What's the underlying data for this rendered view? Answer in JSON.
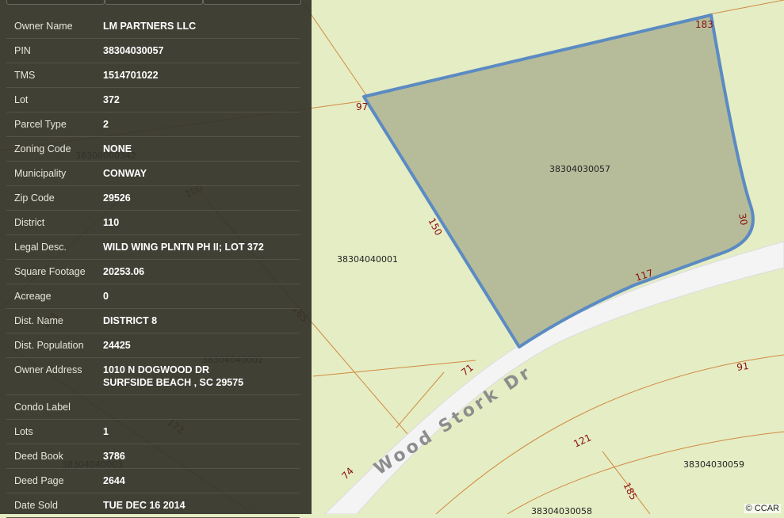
{
  "parcel_panel": {
    "rows": [
      {
        "label": "Owner Name",
        "value": "LM PARTNERS LLC"
      },
      {
        "label": "PIN",
        "value": "38304030057"
      },
      {
        "label": "TMS",
        "value": "1514701022"
      },
      {
        "label": "Lot",
        "value": "372"
      },
      {
        "label": "Parcel Type",
        "value": "2"
      },
      {
        "label": "Zoning Code",
        "value": "NONE"
      },
      {
        "label": "Municipality",
        "value": "CONWAY"
      },
      {
        "label": "Zip Code",
        "value": "29526"
      },
      {
        "label": "District",
        "value": "110"
      },
      {
        "label": "Legal Desc.",
        "value": "WILD WING PLNTN PH II; LOT 372"
      },
      {
        "label": "Square Footage",
        "value": "20253.06"
      },
      {
        "label": "Acreage",
        "value": "0"
      },
      {
        "label": "Dist. Name",
        "value": "DISTRICT 8"
      },
      {
        "label": "Dist. Population",
        "value": "24425"
      },
      {
        "label": "Owner Address",
        "value": "1010 N DOGWOOD DR",
        "value_line2": "SURFSIDE BEACH , SC 29575"
      },
      {
        "label": "Condo Label",
        "value": ""
      },
      {
        "label": "Lots",
        "value": "1"
      },
      {
        "label": "Deed Book",
        "value": "3786"
      },
      {
        "label": "Deed Page",
        "value": "2644"
      },
      {
        "label": "Date Sold",
        "value": "TUE DEC 16 2014"
      }
    ]
  },
  "map": {
    "street_name": "Wood Stork Dr",
    "parcel_labels": {
      "selected": "38304030057",
      "west": "38304040001",
      "behind_panel_1": "38300000342",
      "behind_panel_2": "38304040002",
      "behind_panel_3": "38304040003",
      "southeast": "38304030059",
      "south": "38304030058"
    },
    "dimensions": {
      "north": "183",
      "northwest": "97",
      "west": "150",
      "east": "30",
      "south": "117",
      "road_71": "71",
      "road_74": "74",
      "se_91": "91",
      "se_121": "121",
      "se_185": "185",
      "under_100": "100",
      "under_165": "165",
      "under_101": "101",
      "under_172": "172"
    },
    "credit": "© CCAR",
    "colors": {
      "background": "#e5edc4",
      "selected_fill": "#b6bc9a",
      "selected_outline": "#5b8bc2",
      "lot_lines": "#d08a40",
      "road": "#f4f4f4"
    }
  }
}
